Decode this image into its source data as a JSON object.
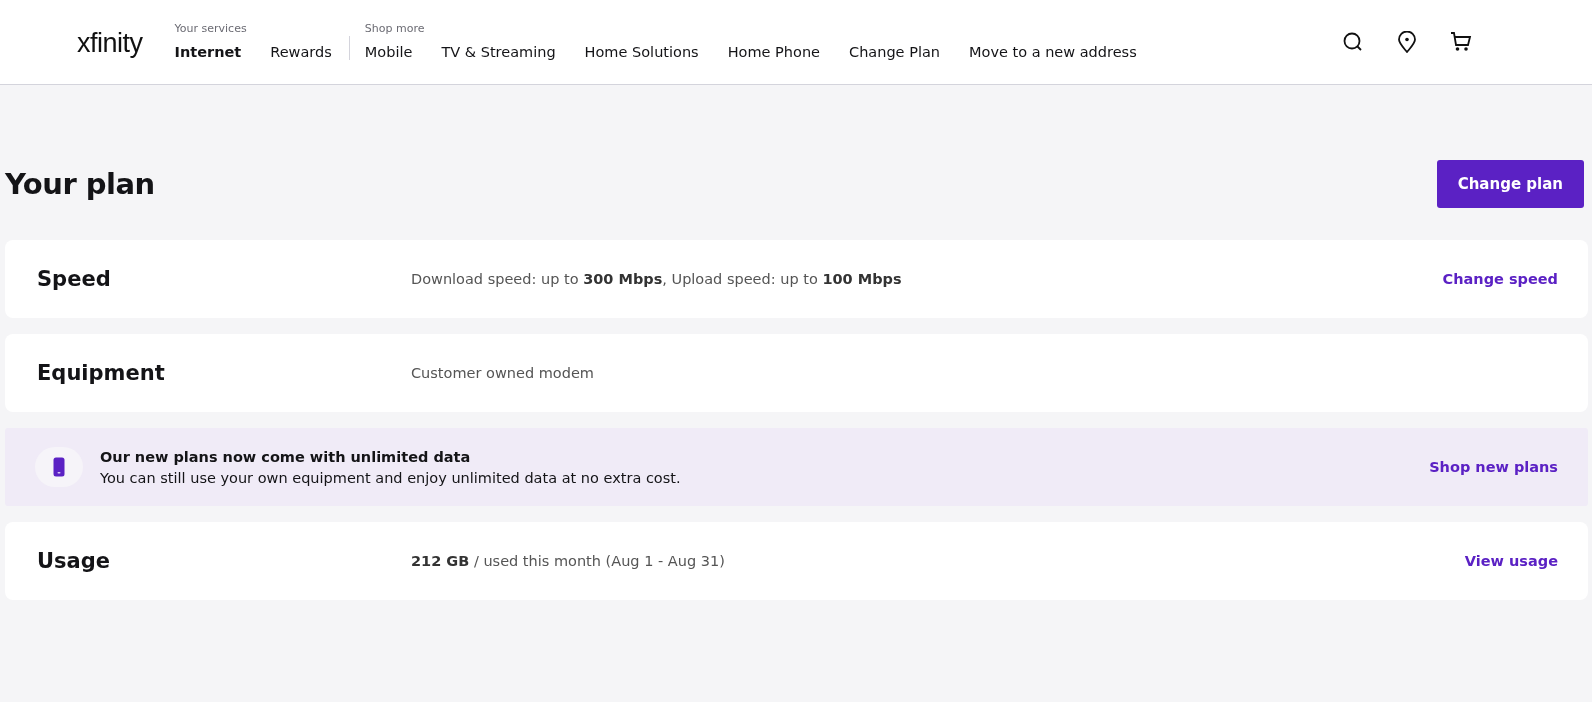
{
  "header": {
    "logo": "xfinity",
    "nav_groups": [
      {
        "label": "Your services",
        "items": [
          {
            "label": "Internet",
            "selected": true
          },
          {
            "label": "Rewards",
            "selected": false
          }
        ]
      },
      {
        "label": "Shop more",
        "items": [
          {
            "label": "Mobile",
            "selected": false
          },
          {
            "label": "TV & Streaming",
            "selected": false
          },
          {
            "label": "Home Solutions",
            "selected": false
          },
          {
            "label": "Home Phone",
            "selected": false
          },
          {
            "label": "Change Plan",
            "selected": false
          },
          {
            "label": "Move to a new address",
            "selected": false
          }
        ]
      }
    ]
  },
  "page": {
    "title": "Your plan",
    "button": "Change plan"
  },
  "rows": [
    {
      "kind": "card",
      "title": "Speed",
      "detail": "Download speed: up to **300 Mbps**, Upload speed: up to **100 Mbps**",
      "link": "Change speed"
    },
    {
      "kind": "card",
      "title": "Equipment",
      "detail": "Customer owned modem"
    },
    {
      "kind": "banner",
      "title": "Our new plans now come with unlimited data",
      "detail": "You can still use your own equipment and enjoy unlimited data at no extra cost.",
      "link": "Shop new plans"
    },
    {
      "kind": "card",
      "title": "Usage",
      "detail": "**212 GB** / used this month (Aug 1 - Aug 31)",
      "link": "View usage"
    }
  ]
}
